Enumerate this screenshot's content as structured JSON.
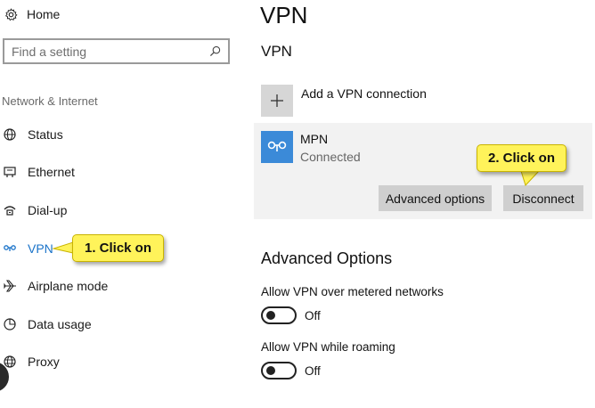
{
  "sidebar": {
    "home_label": "Home",
    "search_placeholder": "Find a setting",
    "section_heading": "Network & Internet",
    "items": [
      {
        "label": "Status",
        "icon": "globe-status-icon"
      },
      {
        "label": "Ethernet",
        "icon": "ethernet-icon"
      },
      {
        "label": "Dial-up",
        "icon": "dialup-icon"
      },
      {
        "label": "VPN",
        "icon": "vpn-icon",
        "active": true
      },
      {
        "label": "Airplane mode",
        "icon": "airplane-icon"
      },
      {
        "label": "Data usage",
        "icon": "data-usage-icon"
      },
      {
        "label": "Proxy",
        "icon": "globe-icon"
      }
    ]
  },
  "main": {
    "title": "VPN",
    "section_title": "VPN",
    "add_label": "Add a VPN connection",
    "connection": {
      "name": "MPN",
      "status": "Connected",
      "advanced_button": "Advanced options",
      "disconnect_button": "Disconnect"
    },
    "advanced_title": "Advanced Options",
    "options": [
      {
        "label": "Allow VPN over metered networks",
        "state": "Off"
      },
      {
        "label": "Allow VPN while roaming",
        "state": "Off"
      }
    ]
  },
  "callouts": {
    "step1": "1. Click on",
    "step2": "2. Click on"
  },
  "colors": {
    "accent": "#1a73c9",
    "vpn_tile": "#3b8ad8",
    "callout_fill": "#fff35a",
    "button_gray": "#cfcfcf"
  }
}
